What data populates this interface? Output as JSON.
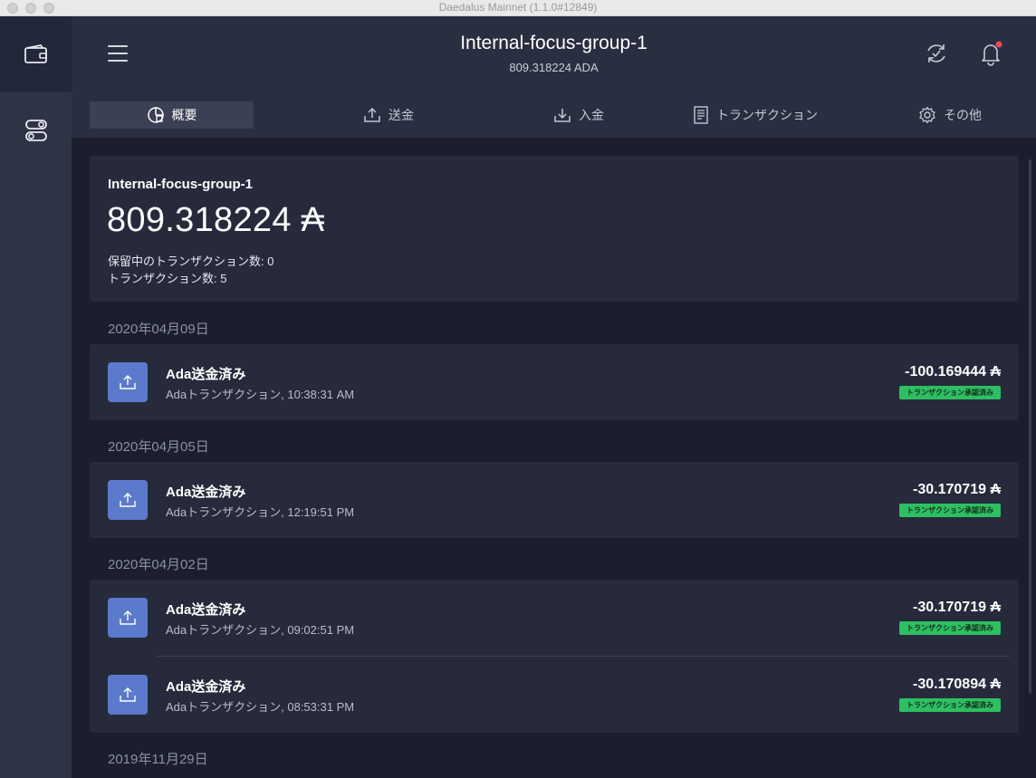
{
  "window": {
    "title": "Daedalus Mainnet (1.1.0#12849)"
  },
  "header": {
    "wallet_name": "Internal-focus-group-1",
    "wallet_balance": "809.318224 ADA"
  },
  "tabs": [
    {
      "label": "概要",
      "icon": "summary-icon",
      "active": true
    },
    {
      "label": "送金",
      "icon": "send-icon"
    },
    {
      "label": "入金",
      "icon": "receive-icon"
    },
    {
      "label": "トランザクション",
      "icon": "transactions-icon"
    },
    {
      "label": "その他",
      "icon": "settings-gear-icon"
    }
  ],
  "summary": {
    "name": "Internal-focus-group-1",
    "amount": "809.318224 ₳",
    "pending": "保留中のトランザクション数: 0",
    "count": "トランザクション数: 5"
  },
  "groups": [
    {
      "date": "2020年04月09日",
      "transactions": [
        {
          "title": "Ada送金済み",
          "subtitle": "Adaトランザクション, 10:38:31 AM",
          "amount": "-100.169444 ₳",
          "status": "トランザクション承認済み"
        }
      ]
    },
    {
      "date": "2020年04月05日",
      "transactions": [
        {
          "title": "Ada送金済み",
          "subtitle": "Adaトランザクション, 12:19:51 PM",
          "amount": "-30.170719 ₳",
          "status": "トランザクション承認済み"
        }
      ]
    },
    {
      "date": "2020年04月02日",
      "transactions": [
        {
          "title": "Ada送金済み",
          "subtitle": "Adaトランザクション, 09:02:51 PM",
          "amount": "-30.170719 ₳",
          "status": "トランザクション承認済み"
        },
        {
          "title": "Ada送金済み",
          "subtitle": "Adaトランザクション, 08:53:31 PM",
          "amount": "-30.170894 ₳",
          "status": "トランザクション承認済み"
        }
      ]
    },
    {
      "date": "2019年11月29日",
      "transactions": []
    }
  ],
  "colors": {
    "background": "#1b1e2c",
    "panel": "#262a3b",
    "sidebar": "#2e3346",
    "tx_icon": "#5c7acc",
    "confirmed_badge": "#2dbf62",
    "notification_dot": "#ea4c5b"
  }
}
